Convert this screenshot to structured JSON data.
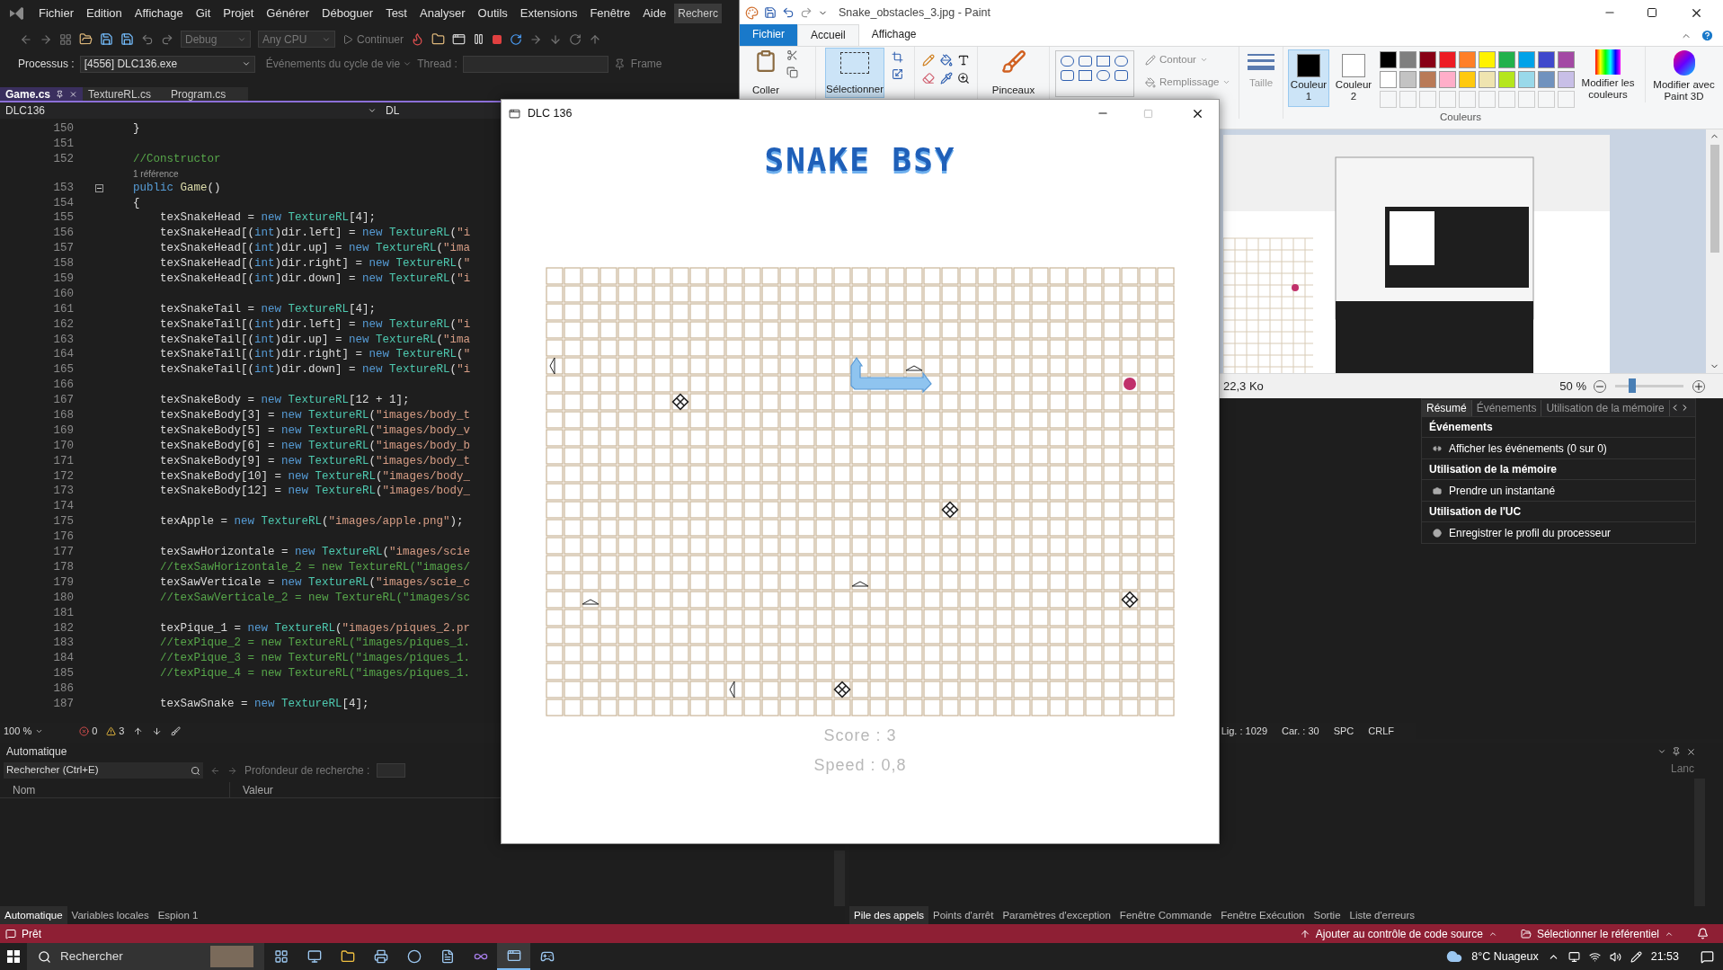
{
  "vs": {
    "menu": [
      "Fichier",
      "Edition",
      "Affichage",
      "Git",
      "Projet",
      "Générer",
      "Déboguer",
      "Test",
      "Analyser",
      "Outils",
      "Extensions",
      "Fenêtre",
      "Aide"
    ],
    "search": "Recherc",
    "toolbar": {
      "configuration": "Debug",
      "platform": "Any CPU",
      "continue": "Continuer"
    },
    "debug_bar": {
      "process_label": "Processus :",
      "process": "[4556] DLC136.exe",
      "lifecycle_events": "Événements du cycle de vie",
      "thread_label": "Thread :",
      "frame": "Frame"
    },
    "tabs": [
      {
        "label": "Game.cs",
        "selected": true
      },
      {
        "label": "TextureRL.cs",
        "selected": false
      },
      {
        "label": "Program.cs",
        "selected": false
      }
    ],
    "navigation": {
      "project": "DLC136",
      "scope": "DL"
    },
    "code": [
      {
        "kind": "code",
        "number": "150",
        "tokens": [
          {
            "kind": "plain",
            "text": "}"
          }
        ]
      },
      {
        "kind": "code",
        "number": "151"
      },
      {
        "kind": "code",
        "number": "152",
        "tokens": [
          {
            "kind": "comment",
            "text": "//Constructor"
          }
        ]
      },
      {
        "kind": "lens",
        "text": "1 référence"
      },
      {
        "kind": "code",
        "number": "153",
        "expanded": true,
        "tokens": [
          {
            "kind": "keyword",
            "text": "public "
          },
          {
            "kind": "method",
            "text": "Game"
          },
          {
            "kind": "plain",
            "text": "()"
          }
        ]
      },
      {
        "kind": "code",
        "number": "154",
        "tokens": [
          {
            "kind": "plain",
            "text": "{"
          }
        ]
      },
      {
        "kind": "code",
        "number": "155",
        "tokens": [
          {
            "kind": "plain",
            "text": "    texSnakeHead = "
          },
          {
            "kind": "keyword",
            "text": "new "
          },
          {
            "kind": "type",
            "text": "TextureRL"
          },
          {
            "kind": "plain",
            "text": "[4];"
          }
        ]
      },
      {
        "kind": "code",
        "number": "156",
        "tokens": [
          {
            "kind": "plain",
            "text": "    texSnakeHead[("
          },
          {
            "kind": "keyword",
            "text": "int"
          },
          {
            "kind": "plain",
            "text": ")dir.left] = "
          },
          {
            "kind": "keyword",
            "text": "new "
          },
          {
            "kind": "type",
            "text": "TextureRL"
          },
          {
            "kind": "plain",
            "text": "("
          },
          {
            "kind": "string",
            "text": "\"i"
          }
        ]
      },
      {
        "kind": "code",
        "number": "157",
        "tokens": [
          {
            "kind": "plain",
            "text": "    texSnakeHead[("
          },
          {
            "kind": "keyword",
            "text": "int"
          },
          {
            "kind": "plain",
            "text": ")dir.up] = "
          },
          {
            "kind": "keyword",
            "text": "new "
          },
          {
            "kind": "type",
            "text": "TextureRL"
          },
          {
            "kind": "plain",
            "text": "("
          },
          {
            "kind": "string",
            "text": "\"ima"
          }
        ]
      },
      {
        "kind": "code",
        "number": "158",
        "tokens": [
          {
            "kind": "plain",
            "text": "    texSnakeHead[("
          },
          {
            "kind": "keyword",
            "text": "int"
          },
          {
            "kind": "plain",
            "text": ")dir.right] = "
          },
          {
            "kind": "keyword",
            "text": "new "
          },
          {
            "kind": "type",
            "text": "TextureRL"
          },
          {
            "kind": "plain",
            "text": "("
          },
          {
            "kind": "string",
            "text": "\""
          }
        ]
      },
      {
        "kind": "code",
        "number": "159",
        "tokens": [
          {
            "kind": "plain",
            "text": "    texSnakeHead[("
          },
          {
            "kind": "keyword",
            "text": "int"
          },
          {
            "kind": "plain",
            "text": ")dir.down] = "
          },
          {
            "kind": "keyword",
            "text": "new "
          },
          {
            "kind": "type",
            "text": "TextureRL"
          },
          {
            "kind": "plain",
            "text": "("
          },
          {
            "kind": "string",
            "text": "\"i"
          }
        ]
      },
      {
        "kind": "code",
        "number": "160"
      },
      {
        "kind": "code",
        "number": "161",
        "tokens": [
          {
            "kind": "plain",
            "text": "    texSnakeTail = "
          },
          {
            "kind": "keyword",
            "text": "new "
          },
          {
            "kind": "type",
            "text": "TextureRL"
          },
          {
            "kind": "plain",
            "text": "[4];"
          }
        ]
      },
      {
        "kind": "code",
        "number": "162",
        "tokens": [
          {
            "kind": "plain",
            "text": "    texSnakeTail[("
          },
          {
            "kind": "keyword",
            "text": "int"
          },
          {
            "kind": "plain",
            "text": ")dir.left] = "
          },
          {
            "kind": "keyword",
            "text": "new "
          },
          {
            "kind": "type",
            "text": "TextureRL"
          },
          {
            "kind": "plain",
            "text": "("
          },
          {
            "kind": "string",
            "text": "\"i"
          }
        ]
      },
      {
        "kind": "code",
        "number": "163",
        "tokens": [
          {
            "kind": "plain",
            "text": "    texSnakeTail[("
          },
          {
            "kind": "keyword",
            "text": "int"
          },
          {
            "kind": "plain",
            "text": ")dir.up] = "
          },
          {
            "kind": "keyword",
            "text": "new "
          },
          {
            "kind": "type",
            "text": "TextureRL"
          },
          {
            "kind": "plain",
            "text": "("
          },
          {
            "kind": "string",
            "text": "\"ima"
          }
        ]
      },
      {
        "kind": "code",
        "number": "164",
        "tokens": [
          {
            "kind": "plain",
            "text": "    texSnakeTail[("
          },
          {
            "kind": "keyword",
            "text": "int"
          },
          {
            "kind": "plain",
            "text": ")dir.right] = "
          },
          {
            "kind": "keyword",
            "text": "new "
          },
          {
            "kind": "type",
            "text": "TextureRL"
          },
          {
            "kind": "plain",
            "text": "("
          },
          {
            "kind": "string",
            "text": "\""
          }
        ]
      },
      {
        "kind": "code",
        "number": "165",
        "tokens": [
          {
            "kind": "plain",
            "text": "    texSnakeTail[("
          },
          {
            "kind": "keyword",
            "text": "int"
          },
          {
            "kind": "plain",
            "text": ")dir.down] = "
          },
          {
            "kind": "keyword",
            "text": "new "
          },
          {
            "kind": "type",
            "text": "TextureRL"
          },
          {
            "kind": "plain",
            "text": "("
          },
          {
            "kind": "string",
            "text": "\"i"
          }
        ]
      },
      {
        "kind": "code",
        "number": "166"
      },
      {
        "kind": "code",
        "number": "167",
        "tokens": [
          {
            "kind": "plain",
            "text": "    texSnakeBody = "
          },
          {
            "kind": "keyword",
            "text": "new "
          },
          {
            "kind": "type",
            "text": "TextureRL"
          },
          {
            "kind": "plain",
            "text": "[12 + 1];"
          }
        ]
      },
      {
        "kind": "code",
        "number": "168",
        "tokens": [
          {
            "kind": "plain",
            "text": "    texSnakeBody[3] = "
          },
          {
            "kind": "keyword",
            "text": "new "
          },
          {
            "kind": "type",
            "text": "TextureRL"
          },
          {
            "kind": "plain",
            "text": "("
          },
          {
            "kind": "string",
            "text": "\"images/body_t"
          }
        ]
      },
      {
        "kind": "code",
        "number": "169",
        "tokens": [
          {
            "kind": "plain",
            "text": "    texSnakeBody[5] = "
          },
          {
            "kind": "keyword",
            "text": "new "
          },
          {
            "kind": "type",
            "text": "TextureRL"
          },
          {
            "kind": "plain",
            "text": "("
          },
          {
            "kind": "string",
            "text": "\"images/body_v"
          }
        ]
      },
      {
        "kind": "code",
        "number": "170",
        "tokens": [
          {
            "kind": "plain",
            "text": "    texSnakeBody[6] = "
          },
          {
            "kind": "keyword",
            "text": "new "
          },
          {
            "kind": "type",
            "text": "TextureRL"
          },
          {
            "kind": "plain",
            "text": "("
          },
          {
            "kind": "string",
            "text": "\"images/body_b"
          }
        ]
      },
      {
        "kind": "code",
        "number": "171",
        "tokens": [
          {
            "kind": "plain",
            "text": "    texSnakeBody[9] = "
          },
          {
            "kind": "keyword",
            "text": "new "
          },
          {
            "kind": "type",
            "text": "TextureRL"
          },
          {
            "kind": "plain",
            "text": "("
          },
          {
            "kind": "string",
            "text": "\"images/body_t"
          }
        ]
      },
      {
        "kind": "code",
        "number": "172",
        "tokens": [
          {
            "kind": "plain",
            "text": "    texSnakeBody[10] = "
          },
          {
            "kind": "keyword",
            "text": "new "
          },
          {
            "kind": "type",
            "text": "TextureRL"
          },
          {
            "kind": "plain",
            "text": "("
          },
          {
            "kind": "string",
            "text": "\"images/body_"
          }
        ]
      },
      {
        "kind": "code",
        "number": "173",
        "tokens": [
          {
            "kind": "plain",
            "text": "    texSnakeBody[12] = "
          },
          {
            "kind": "keyword",
            "text": "new "
          },
          {
            "kind": "type",
            "text": "TextureRL"
          },
          {
            "kind": "plain",
            "text": "("
          },
          {
            "kind": "string",
            "text": "\"images/body_"
          }
        ]
      },
      {
        "kind": "code",
        "number": "174"
      },
      {
        "kind": "code",
        "number": "175",
        "tokens": [
          {
            "kind": "plain",
            "text": "    texApple = "
          },
          {
            "kind": "keyword",
            "text": "new "
          },
          {
            "kind": "type",
            "text": "TextureRL"
          },
          {
            "kind": "plain",
            "text": "("
          },
          {
            "kind": "string",
            "text": "\"images/apple.png\""
          },
          {
            "kind": "plain",
            "text": ");"
          }
        ]
      },
      {
        "kind": "code",
        "number": "176"
      },
      {
        "kind": "code",
        "number": "177",
        "tokens": [
          {
            "kind": "plain",
            "text": "    texSawHorizontale = "
          },
          {
            "kind": "keyword",
            "text": "new "
          },
          {
            "kind": "type",
            "text": "TextureRL"
          },
          {
            "kind": "plain",
            "text": "("
          },
          {
            "kind": "string",
            "text": "\"images/scie"
          }
        ]
      },
      {
        "kind": "code",
        "number": "178",
        "tokens": [
          {
            "kind": "comment",
            "text": "    //texSawHorizontale_2 = new TextureRL(\"images/"
          }
        ]
      },
      {
        "kind": "code",
        "number": "179",
        "tokens": [
          {
            "kind": "plain",
            "text": "    texSawVerticale = "
          },
          {
            "kind": "keyword",
            "text": "new "
          },
          {
            "kind": "type",
            "text": "TextureRL"
          },
          {
            "kind": "plain",
            "text": "("
          },
          {
            "kind": "string",
            "text": "\"images/scie_c"
          }
        ]
      },
      {
        "kind": "code",
        "number": "180",
        "tokens": [
          {
            "kind": "comment",
            "text": "    //texSawVerticale_2 = new TextureRL(\"images/sc"
          }
        ]
      },
      {
        "kind": "code",
        "number": "181"
      },
      {
        "kind": "code",
        "number": "182",
        "tokens": [
          {
            "kind": "plain",
            "text": "    texPique_1 = "
          },
          {
            "kind": "keyword",
            "text": "new "
          },
          {
            "kind": "type",
            "text": "TextureRL"
          },
          {
            "kind": "plain",
            "text": "("
          },
          {
            "kind": "string",
            "text": "\"images/piques_2.pr"
          }
        ]
      },
      {
        "kind": "code",
        "number": "183",
        "tokens": [
          {
            "kind": "comment",
            "text": "    //texPique_2 = new TextureRL(\"images/piques_1."
          }
        ]
      },
      {
        "kind": "code",
        "number": "184",
        "tokens": [
          {
            "kind": "comment",
            "text": "    //texPique_3 = new TextureRL(\"images/piques_1."
          }
        ]
      },
      {
        "kind": "code",
        "number": "185",
        "tokens": [
          {
            "kind": "comment",
            "text": "    //texPique_4 = new TextureRL(\"images/piques_1."
          }
        ]
      },
      {
        "kind": "code",
        "number": "186"
      },
      {
        "kind": "code",
        "number": "187",
        "tokens": [
          {
            "kind": "plain",
            "text": "    texSawSnake = "
          },
          {
            "kind": "keyword",
            "text": "new "
          },
          {
            "kind": "type",
            "text": "TextureRL"
          },
          {
            "kind": "plain",
            "text": "[4];"
          }
        ]
      }
    ],
    "editor_status": {
      "zoom": "100 %",
      "errors": "0",
      "warnings": "3",
      "line": "Lig. : 1029",
      "column": "Car. : 30",
      "whitespace": "SPC",
      "line_ending": "CRLF"
    },
    "diagnostics": {
      "tabs": [
        {
          "label": "Résumé",
          "selected": true
        },
        {
          "label": "Événements",
          "selected": false
        },
        {
          "label": "Utilisation de la mémoire",
          "selected": false
        }
      ],
      "sections": [
        {
          "kind": "events",
          "title": "Événements",
          "action": "Afficher les événements (0 sur 0)"
        },
        {
          "kind": "snapshot",
          "title": "Utilisation de la mémoire",
          "action": "Prendre un instantané"
        },
        {
          "kind": "record",
          "title": "Utilisation de l'UC",
          "action": "Enregistrer le profil du processeur"
        }
      ]
    },
    "autos_panel": {
      "title": "Automatique",
      "search_placeholder": "Rechercher (Ctrl+E)",
      "depth_label": "Profondeur de recherche :",
      "columns": [
        "Nom",
        "Valeur"
      ],
      "tabs": [
        {
          "label": "Automatique",
          "selected": true
        },
        {
          "label": "Variables locales",
          "selected": false
        },
        {
          "label": "Espion 1",
          "selected": false
        }
      ]
    },
    "call_stack_panel": {
      "column_1": "Lanc",
      "tabs": [
        {
          "label": "Pile des appels",
          "selected": true
        },
        {
          "label": "Points d'arrêt",
          "selected": false
        },
        {
          "label": "Paramètres d'exception",
          "selected": false
        },
        {
          "label": "Fenêtre Commande",
          "selected": false
        },
        {
          "label": "Fenêtre Exécution",
          "selected": false
        },
        {
          "label": "Sortie",
          "selected": false
        },
        {
          "label": "Liste d'erreurs",
          "selected": false
        }
      ]
    },
    "status_bar": {
      "state": "Prêt",
      "source_control": "Ajouter au contrôle de code source",
      "repository": "Sélectionner le référentiel"
    }
  },
  "paint": {
    "title": "Snake_obstacles_3.jpg - Paint",
    "tabs": [
      {
        "kind": "file",
        "label": "Fichier",
        "selected": false
      },
      {
        "kind": "tab",
        "label": "Accueil",
        "selected": true
      },
      {
        "kind": "tab",
        "label": "Affichage",
        "selected": false
      }
    ],
    "tools": {
      "paste": "Coller",
      "select": {
        "label": "Sélectionner",
        "selected": true
      },
      "brushes": "Pinceaux",
      "outline": "Contour",
      "fill": "Remplissage",
      "size": "Taille"
    },
    "color_slots": [
      {
        "label": "Couleur 1",
        "color": "#000000",
        "selected": true
      },
      {
        "label": "Couleur 2",
        "color": "#ffffff",
        "selected": false
      }
    ],
    "palette": [
      {
        "color": "#000000"
      },
      {
        "color": "#7f7f7f"
      },
      {
        "color": "#880015"
      },
      {
        "color": "#ed1c24"
      },
      {
        "color": "#ff7f27"
      },
      {
        "color": "#fff200"
      },
      {
        "color": "#22b14c"
      },
      {
        "color": "#00a2e8"
      },
      {
        "color": "#3f48cc"
      },
      {
        "color": "#a349a4"
      },
      {
        "color": "#ffffff"
      },
      {
        "color": "#c3c3c3"
      },
      {
        "color": "#b97a57"
      },
      {
        "color": "#ffaec9"
      },
      {
        "color": "#ffc90e"
      },
      {
        "color": "#efe4b0"
      },
      {
        "color": "#b5e61d"
      },
      {
        "color": "#99d9ea"
      },
      {
        "color": "#7092be"
      },
      {
        "color": "#c8bfe7"
      }
    ],
    "colors_group": "Couleurs",
    "edit_colors": "Modifier les couleurs",
    "paint3d": "Modifier avec Paint 3D",
    "status": {
      "file_size": "22,3 Ko",
      "zoom": "50 %",
      "zoom_slider": {
        "level": 0.25
      }
    }
  },
  "game": {
    "title": "DLC 136",
    "logo": "SNAKE BSY",
    "score": "Score : 3",
    "speed": "Speed : 0,8"
  },
  "taskbar": {
    "search_placeholder": "Rechercher",
    "weather": "8°C Nuageux",
    "time": "21:53"
  }
}
